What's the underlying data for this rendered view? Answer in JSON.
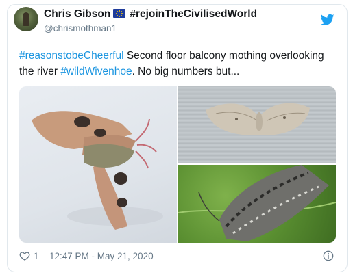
{
  "tweet": {
    "author_name": "Chris Gibson",
    "author_flag_icon": "eu-flag-icon",
    "author_name_suffix": "#rejoinTheCivilisedWorld",
    "handle": "@chrismothman1",
    "text_parts": {
      "hashtag1": "#reasonstobeCheerful",
      "body1": " Second floor balcony mothing overlooking the river ",
      "hashtag2": "#wildWivenhoe",
      "body2": ". No big numbers but..."
    },
    "likes": "1",
    "timestamp": "12:47 PM - May 21, 2020",
    "icons": {
      "platform": "twitter-bird-icon",
      "like": "heart-icon",
      "info": "info-icon"
    },
    "colors": {
      "link": "#1b95e0",
      "meta": "#657786",
      "brand": "#1da1f2"
    },
    "media": [
      {
        "name": "moth-photo-large"
      },
      {
        "name": "moth-photo-pale"
      },
      {
        "name": "moth-photo-grey-on-leaf"
      }
    ]
  }
}
